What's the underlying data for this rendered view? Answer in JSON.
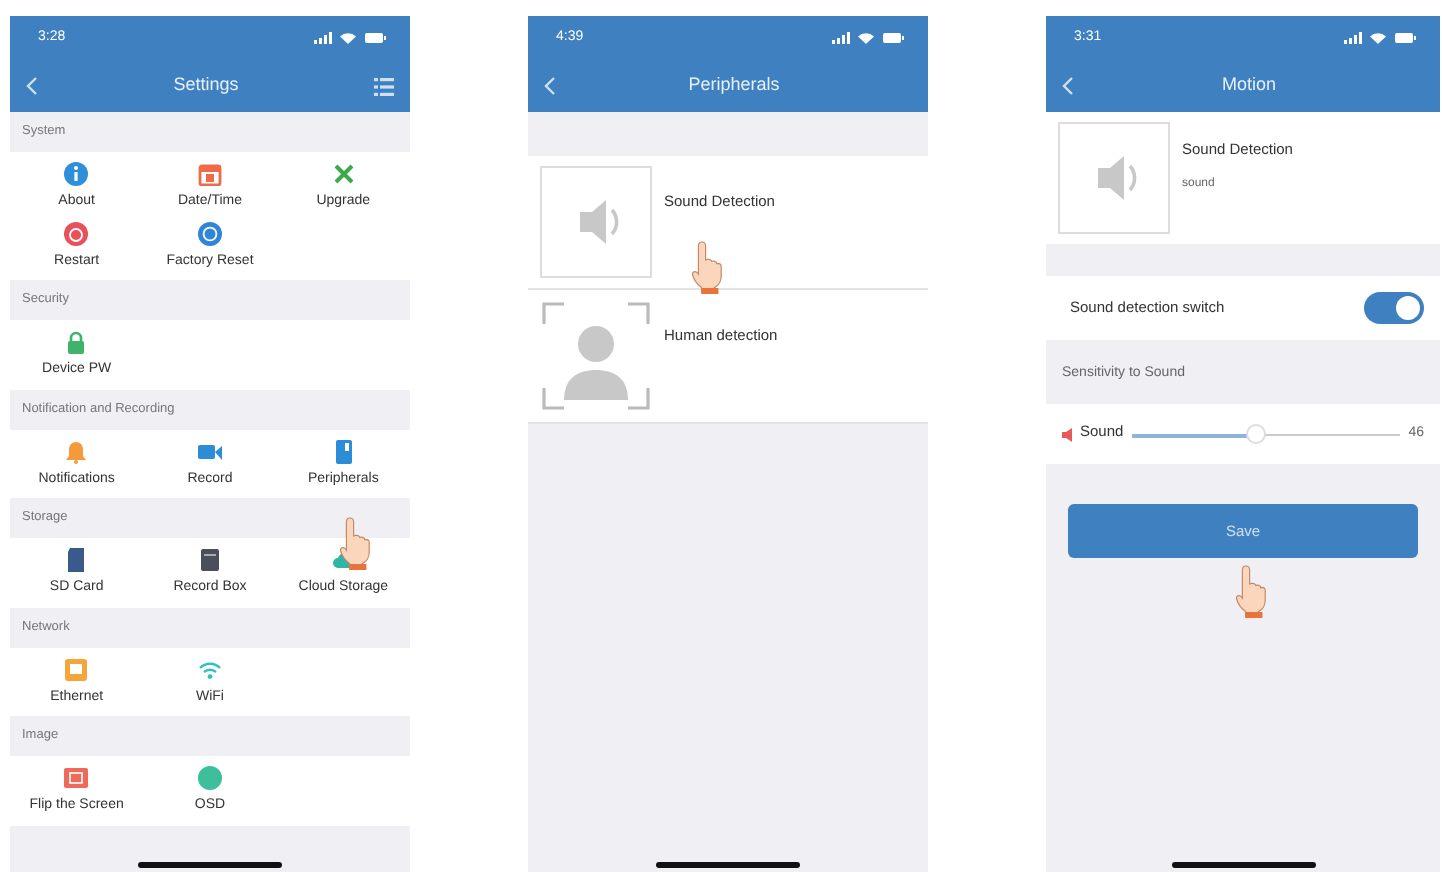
{
  "phones": [
    {
      "kind": "settings",
      "status_time": "3:28",
      "title": "Settings",
      "sections": [
        {
          "heading": "System",
          "items": [
            "About",
            "Date/Time",
            "Upgrade",
            "Restart",
            "Factory Reset"
          ]
        },
        {
          "heading": "Security",
          "items": [
            "Device PW"
          ]
        },
        {
          "heading": "Notification and Recording",
          "items": [
            "Notifications",
            "Record",
            "Peripherals"
          ]
        },
        {
          "heading": "Storage",
          "items": [
            "SD Card",
            "Record Box",
            "Cloud Storage"
          ]
        },
        {
          "heading": "Network",
          "items": [
            "Ethernet",
            "WiFi"
          ]
        },
        {
          "heading": "Image",
          "items": [
            "Flip the Screen",
            "OSD"
          ]
        }
      ]
    },
    {
      "kind": "peripherals",
      "status_time": "4:39",
      "title": "Peripherals",
      "items": [
        {
          "label": "Sound Detection"
        },
        {
          "label": "Human detection"
        }
      ]
    },
    {
      "kind": "motion",
      "status_time": "3:31",
      "title": "Motion",
      "detector": {
        "name": "Sound Detection",
        "subtitle": "sound"
      },
      "switch": {
        "label": "Sound detection switch",
        "on": true
      },
      "section_heading": "Sensitivity to Sound",
      "slider": {
        "label": "Sound",
        "level": 0.46,
        "reading": "46"
      },
      "save_button": "Save"
    }
  ]
}
